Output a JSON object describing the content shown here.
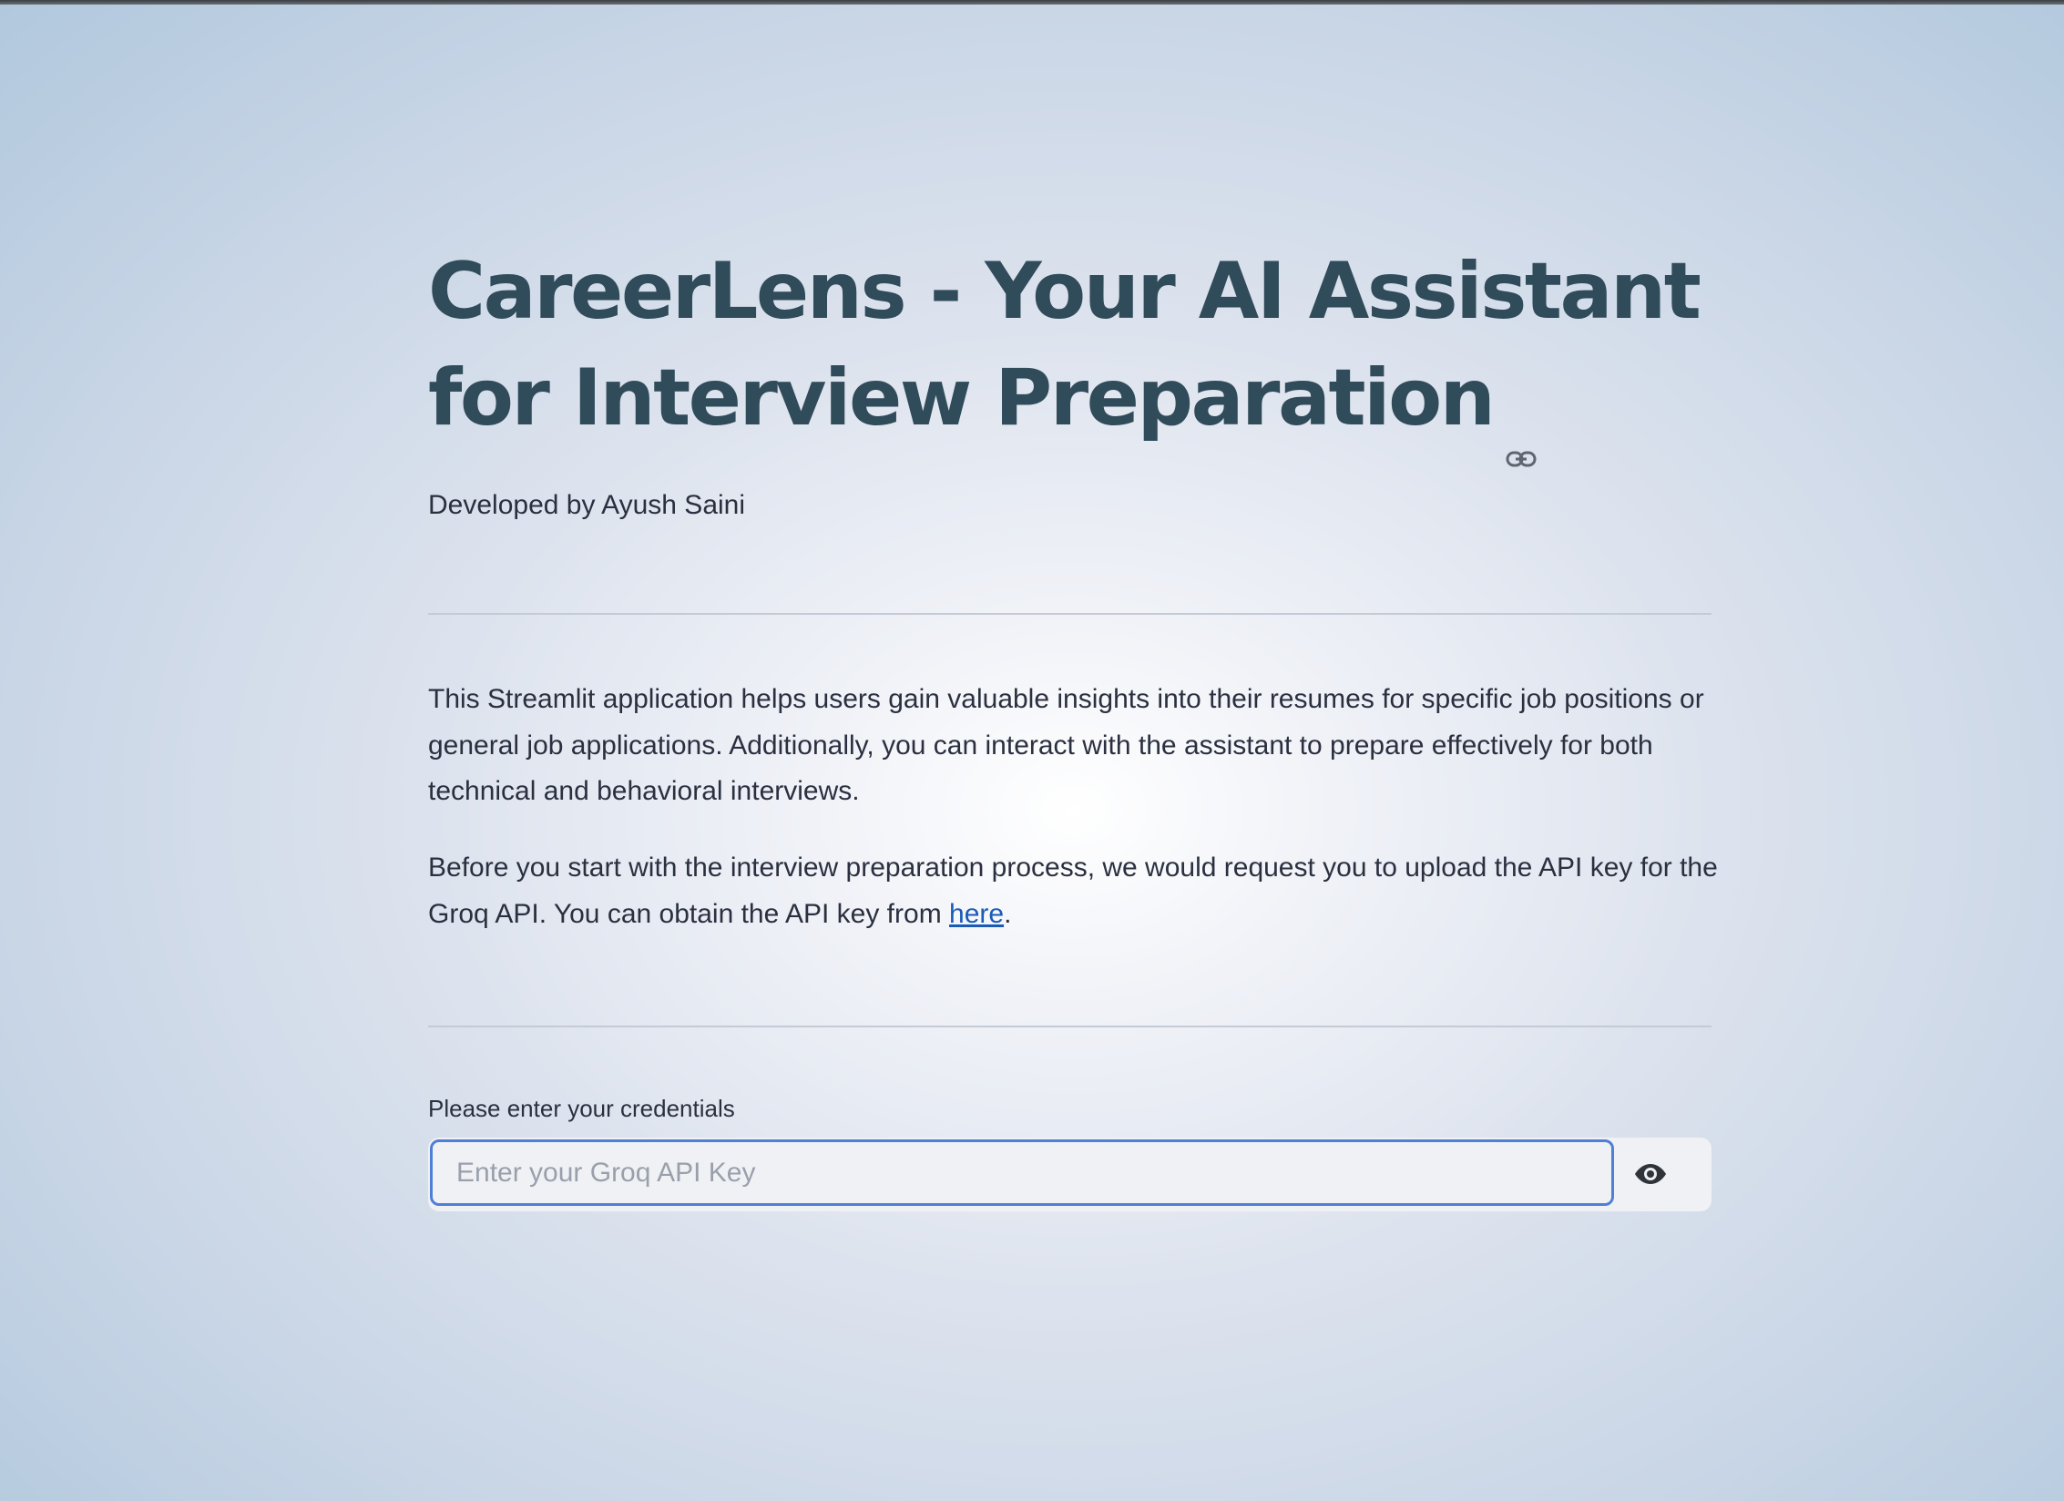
{
  "page": {
    "title": "CareerLens - Your AI Assistant for Interview Preparation",
    "subtitle": "Developed by Ayush Saini"
  },
  "intro": {
    "paragraph1": "This Streamlit application helps users gain valuable insights into their resumes for specific job positions or general job applications. Additionally, you can interact with the assistant to prepare effectively for both technical and behavioral interviews.",
    "paragraph2_text": "Before you start with the interview preparation process, we would request you to upload the API key for the Groq API. You can obtain the API key from ",
    "paragraph2_link": "here",
    "paragraph2_end": "."
  },
  "credentials": {
    "label": "Please enter your credentials",
    "input_value": "",
    "input_placeholder": "Enter your Groq API Key",
    "toggle_icon": "eye-icon"
  },
  "colors": {
    "title": "#304b5a",
    "link": "#1a5bb8",
    "input_focus_border": "#4f7fd6"
  }
}
